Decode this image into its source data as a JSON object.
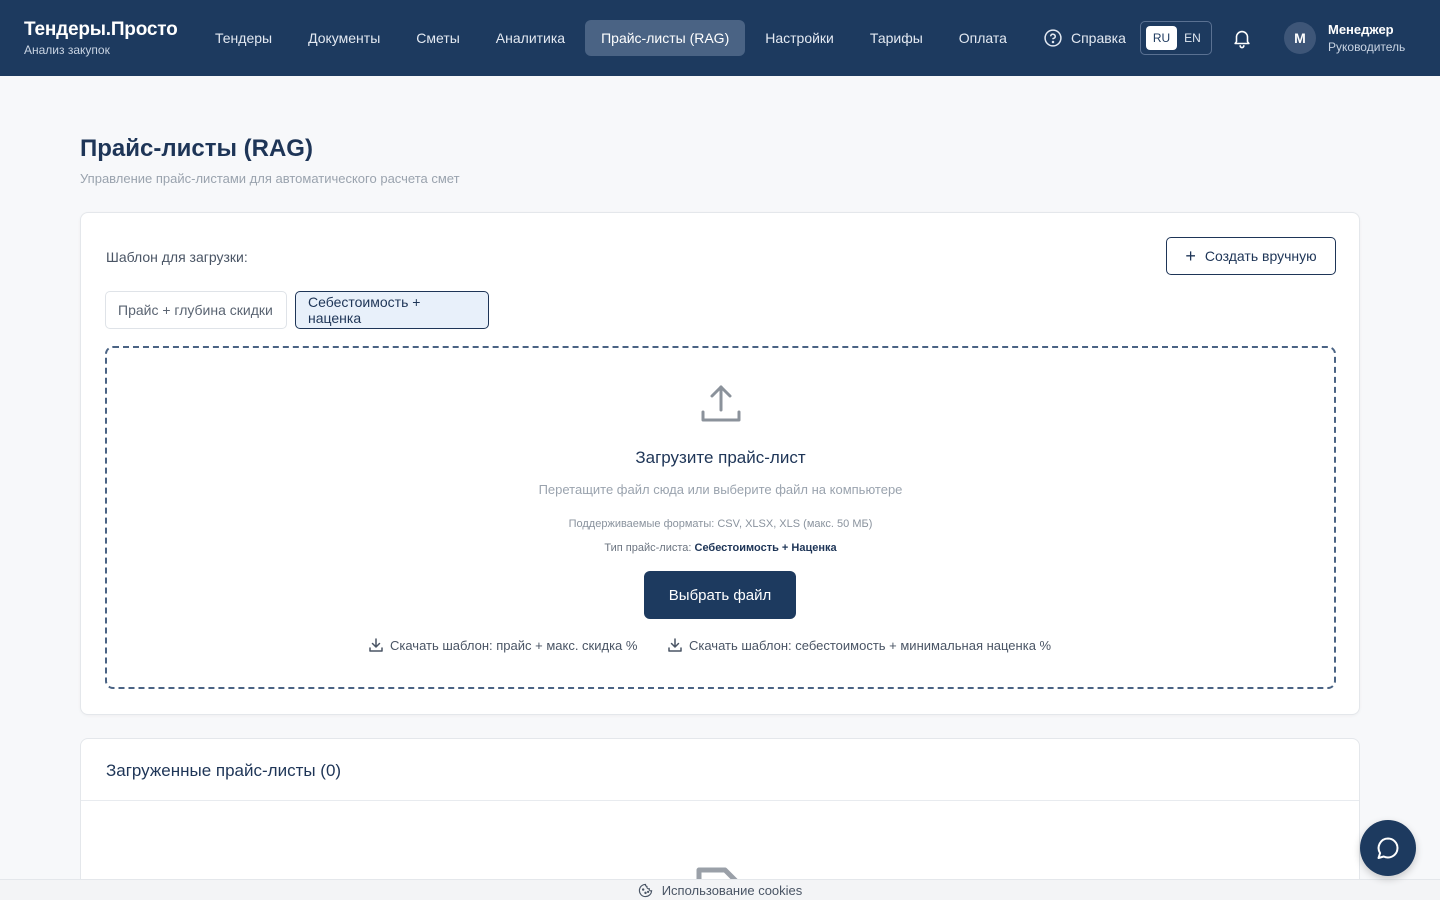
{
  "brand": {
    "title": "Тендеры.Просто",
    "subtitle": "Анализ закупок"
  },
  "nav": {
    "items": [
      {
        "label": "Тендеры"
      },
      {
        "label": "Документы"
      },
      {
        "label": "Сметы"
      },
      {
        "label": "Аналитика"
      },
      {
        "label": "Прайс-листы (RAG)",
        "active": true
      },
      {
        "label": "Настройки"
      },
      {
        "label": "Тарифы"
      },
      {
        "label": "Оплата"
      }
    ],
    "help": {
      "label": "Справка",
      "icon": "question-circle-icon"
    }
  },
  "lang": {
    "options": [
      "RU",
      "EN"
    ],
    "selected": "RU"
  },
  "user": {
    "initial": "М",
    "name": "Менеджер",
    "role": "Руководитель"
  },
  "page": {
    "title": "Прайс-листы (RAG)",
    "subtitle": "Управление прайс-листами для автоматического расчета смет"
  },
  "upload": {
    "template_label": "Шаблон для загрузки:",
    "create_manual": "Создать вручную",
    "tabs": [
      {
        "label": "Прайс + глубина скидки",
        "selected": false
      },
      {
        "label": "Себестоимость + наценка",
        "selected": true
      }
    ],
    "title": "Загрузите прайс-лист",
    "subtitle": "Перетащите файл сюда или выберите файл на компьютере",
    "formats": "Поддерживаемые форматы: CSV, XLSX, XLS (макс. 50 МБ)",
    "type_label": "Тип прайс-листа:",
    "type_value": "Себестоимость + Наценка",
    "choose_button": "Выбрать файл",
    "download_links": [
      "Скачать шаблон: прайс + макс. скидка %",
      "Скачать шаблон: себестоимость + минимальная наценка %"
    ]
  },
  "uploaded": {
    "title": "Загруженные прайс-листы (0)"
  },
  "cookie": {
    "label": "Использование cookies"
  },
  "colors": {
    "header_bg": "#1d3a5f",
    "accent": "#1e3557",
    "active_nav": "#4a6384"
  }
}
